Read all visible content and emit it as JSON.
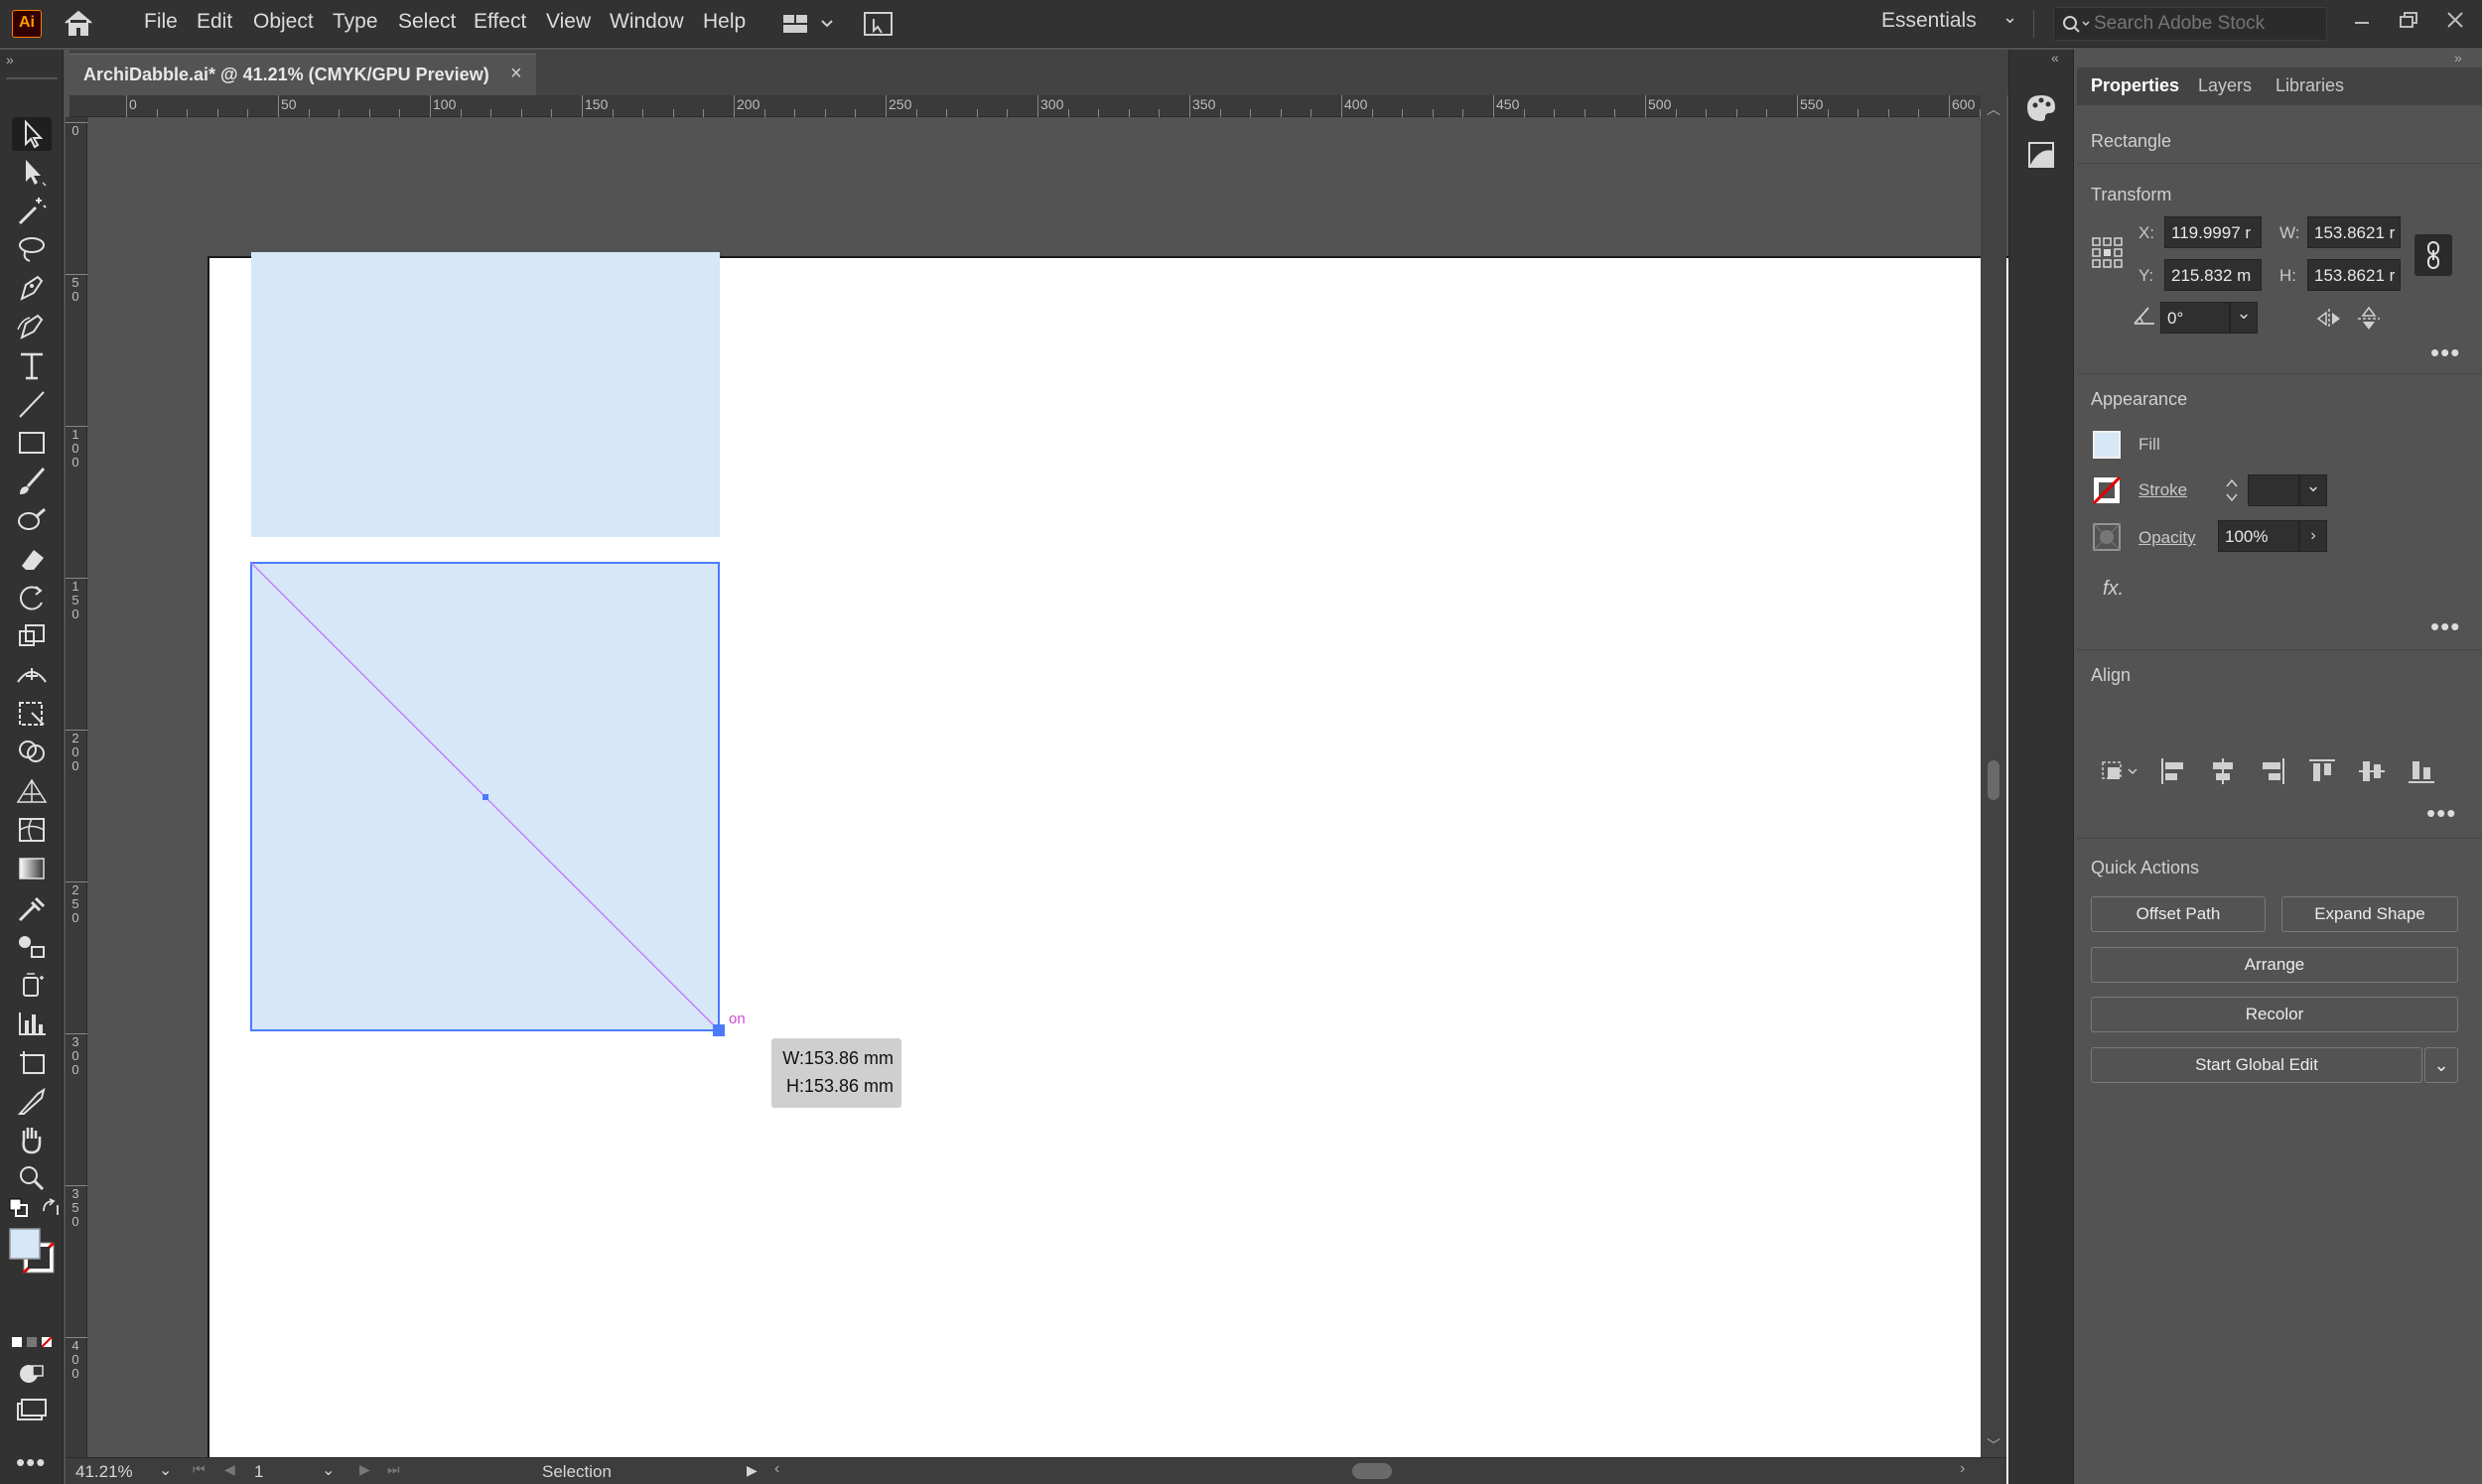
{
  "app": {
    "logo": "Ai",
    "menu": [
      "File",
      "Edit",
      "Object",
      "Type",
      "Select",
      "Effect",
      "View",
      "Window",
      "Help"
    ],
    "workspace": "Essentials",
    "search_placeholder": "Search Adobe Stock"
  },
  "document": {
    "tab_title": "ArchiDabble.ai* @ 41.21% (CMYK/GPU Preview)",
    "close": "×"
  },
  "ruler": {
    "top_labels": [
      "0",
      "50",
      "100",
      "150",
      "200",
      "250",
      "300",
      "350",
      "400",
      "450",
      "500",
      "550",
      "600"
    ],
    "left_labels": [
      "0",
      "5\n0",
      "1\n0\n0",
      "1\n5\n0",
      "2\n0\n0",
      "2\n5\n0",
      "3\n0\n0",
      "3\n5\n0",
      "4\n0\n0"
    ]
  },
  "canvas": {
    "tooltip_w": "W:153.86 mm",
    "tooltip_h": "H:153.86 mm",
    "smart_guide": "on",
    "shape_fill": "#d6e7f7",
    "selection_color": "#4a7bff",
    "guide_color": "#c77dff"
  },
  "status": {
    "zoom": "41.21%",
    "artboard_num": "1",
    "tool_name": "Selection"
  },
  "panel": {
    "tabs": [
      "Properties",
      "Layers",
      "Libraries"
    ],
    "object_type": "Rectangle",
    "transform": {
      "label": "Transform",
      "x_label": "X:",
      "x_value": "119.9997 r",
      "y_label": "Y:",
      "y_value": "215.832 m",
      "w_label": "W:",
      "w_value": "153.8621 r",
      "h_label": "H:",
      "h_value": "153.8621 r",
      "angle_value": "0°"
    },
    "appearance": {
      "label": "Appearance",
      "fill_label": "Fill",
      "stroke_label": "Stroke",
      "opacity_label": "Opacity",
      "opacity_value": "100%",
      "fx_label": "fx."
    },
    "align": {
      "label": "Align"
    },
    "quick_actions": {
      "label": "Quick Actions",
      "offset_path": "Offset Path",
      "expand_shape": "Expand Shape",
      "arrange": "Arrange",
      "recolor": "Recolor",
      "global_edit": "Start Global Edit"
    }
  }
}
